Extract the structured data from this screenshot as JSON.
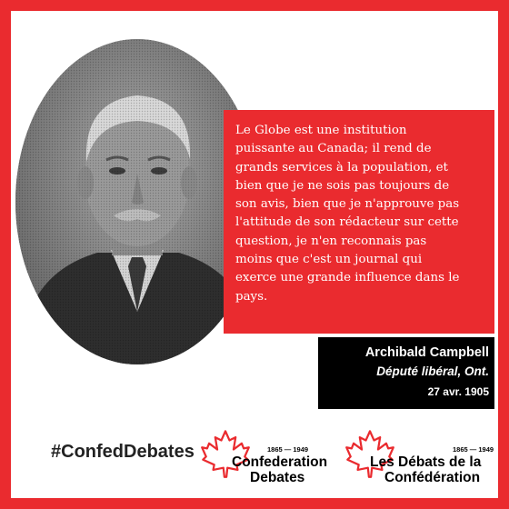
{
  "colors": {
    "accent": "#ea2b2f",
    "dark": "#000000",
    "text_light": "#ffffff"
  },
  "quote": {
    "lines": [
      "Le Globe est une institution",
      "puissante au Canada; il rend de",
      "grands services à la population, et",
      "bien que je ne sois pas toujours de",
      "son avis, bien que je n'approuve pas",
      "l'attitude de son rédacteur sur cette",
      "question, je n'en reconnais pas",
      "moins que c'est un journal qui",
      "exerce une grande influence dans le",
      "pays."
    ]
  },
  "attribution": {
    "name": "Archibald Campbell",
    "title": "Député libéral, Ont.",
    "date": "27 avr. 1905"
  },
  "hashtag": "#ConfedDebates",
  "logos": {
    "english": {
      "years": "1865 — 1949",
      "line1": "Confederation",
      "line2": "Debates",
      "icon": "maple-leaf-icon"
    },
    "french": {
      "years": "1865 — 1949",
      "line1": "Les Débats de la",
      "line2": "Confédération",
      "icon": "maple-leaf-icon"
    }
  }
}
